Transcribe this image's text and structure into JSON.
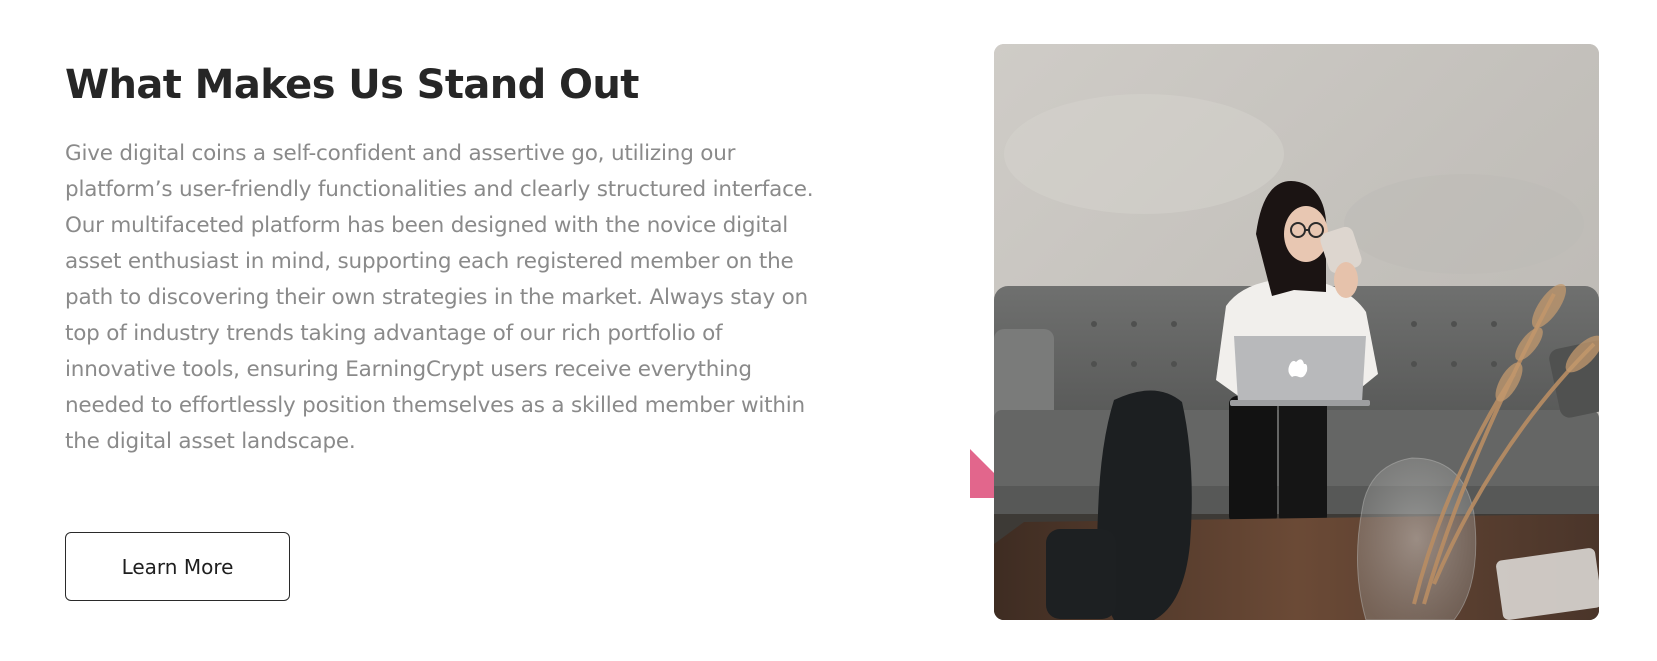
{
  "feature": {
    "title": "What Makes Us Stand Out",
    "description": "Give digital coins a self-confident and assertive go, utilizing our platform’s user-friendly functionalities and clearly structured interface. Our multifaceted platform has been designed with the novice digital asset enthusiast in mind, supporting each registered member on the path to discovering their own strategies in the market. Always stay on top of industry trends taking advantage of our rich portfolio of innovative tools, ensuring EarningCrypt users receive everything needed to effortlessly position themselves as a skilled member within the digital asset landscape.",
    "cta_label": "Learn More"
  },
  "image": {
    "alt": "Woman sipping from a mug while using a laptop on a grey sofa"
  },
  "colors": {
    "heading": "#262626",
    "body_text": "#8a8a8a",
    "accent": "#e2668c",
    "button_border": "#2a2a2a"
  }
}
